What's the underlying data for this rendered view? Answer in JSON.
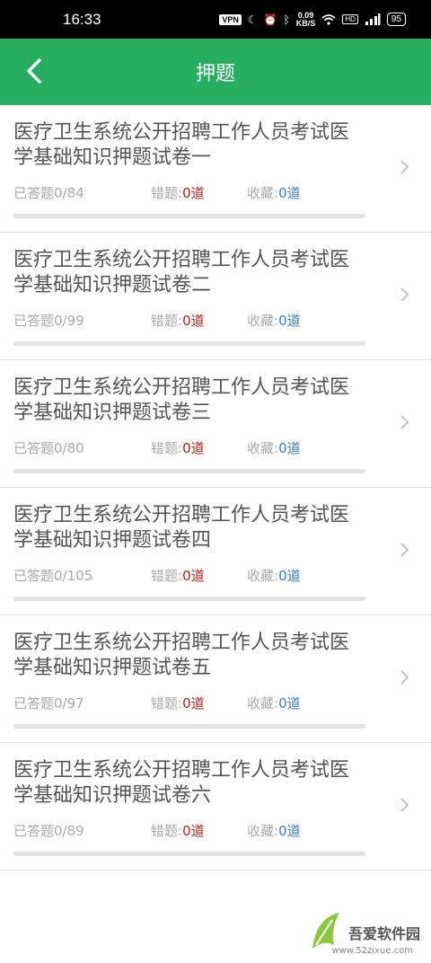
{
  "status_bar": {
    "time": "16:33",
    "vpn": "VPN",
    "speed_value": "0.09",
    "speed_unit": "KB/S",
    "hd": "HD",
    "battery": "95"
  },
  "header": {
    "title": "押题"
  },
  "labels": {
    "answered": "已答题",
    "wrong": "错题:",
    "favorite": "收藏:"
  },
  "colors": {
    "accent": "#27ae60",
    "wrong_value": "#b0211f",
    "favorite_value": "#3c7cc9"
  },
  "papers": [
    {
      "title": "医疗卫生系统公开招聘工作人员考试医学基础知识押题试卷一",
      "answered": "0/84",
      "answered_fraction": 0,
      "wrong": "0道",
      "favorite": "0道"
    },
    {
      "title": "医疗卫生系统公开招聘工作人员考试医学基础知识押题试卷二",
      "answered": "0/99",
      "answered_fraction": 0,
      "wrong": "0道",
      "favorite": "0道"
    },
    {
      "title": "医疗卫生系统公开招聘工作人员考试医学基础知识押题试卷三",
      "answered": "0/80",
      "answered_fraction": 0,
      "wrong": "0道",
      "favorite": "0道"
    },
    {
      "title": "医疗卫生系统公开招聘工作人员考试医学基础知识押题试卷四",
      "answered": "0/105",
      "answered_fraction": 0,
      "wrong": "0道",
      "favorite": "0道"
    },
    {
      "title": "医疗卫生系统公开招聘工作人员考试医学基础知识押题试卷五",
      "answered": "0/97",
      "answered_fraction": 0,
      "wrong": "0道",
      "favorite": "0道"
    },
    {
      "title": "医疗卫生系统公开招聘工作人员考试医学基础知识押题试卷六",
      "answered": "0/89",
      "answered_fraction": 0,
      "wrong": "0道",
      "favorite": "0道"
    }
  ],
  "watermark": {
    "text": "吾爱软件园",
    "url": "www.52zixue.com"
  }
}
